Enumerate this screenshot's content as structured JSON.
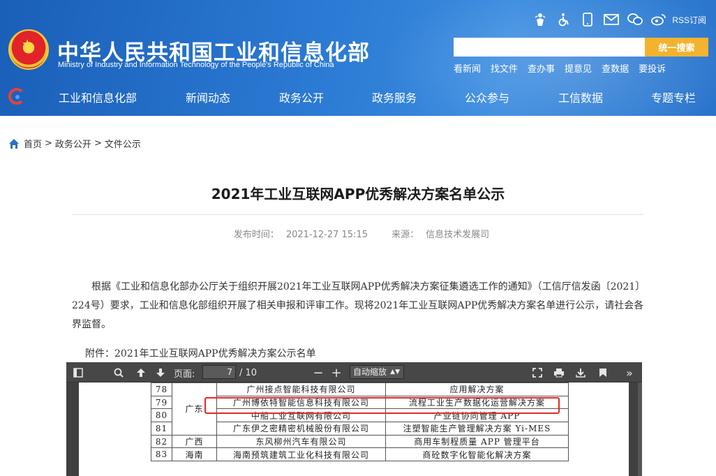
{
  "header": {
    "title": "中华人民共和国工业和信息化部",
    "subtitle": "Ministry of Industry and Information Technology of the People's Republic of China",
    "rss_label": "RSS订阅",
    "search": {
      "placeholder": "",
      "button": "统一搜索"
    },
    "quick_links": [
      "看新闻",
      "找文件",
      "查办事",
      "提意见",
      "查数据",
      "要投诉"
    ],
    "nav": [
      "工业和信息化部",
      "新闻动态",
      "政务公开",
      "政务服务",
      "公众参与",
      "工信数据",
      "专题专栏"
    ],
    "top_icons": [
      "accessibility-elder-icon",
      "wheelchair-icon",
      "mobile-icon",
      "mail-icon",
      "wechat-icon",
      "weibo-icon"
    ]
  },
  "breadcrumb": [
    "首页",
    "政务公开",
    "文件公示"
  ],
  "article": {
    "title": "2021年工业互联网APP优秀解决方案名单公示",
    "publish_label": "发布时间：",
    "publish_time": "2021-12-27 15:15",
    "source_label": "来源：",
    "source": "信息技术发展司",
    "body": "根据《工业和信息化部办公厅关于组织开展2021年工业互联网APP优秀解决方案征集遴选工作的通知》（工信厅信发函〔2021〕224号）要求，工业和信息化部组织开展了相关申报和评审工作。现将2021年工业互联网APP优秀解决方案名单进行公示，请社会各界监督。",
    "attachment": "附件：2021年工业互联网APP优秀解决方案公示名单"
  },
  "pdf_viewer": {
    "page_label": "页面:",
    "current_page": "7",
    "total_pages": "/ 10",
    "zoom": "自动缩放",
    "rows": [
      {
        "no": "78",
        "prov": "",
        "company": "广州接点智能科技有限公司",
        "solution": "应用解决方案"
      },
      {
        "no": "79",
        "prov": "广东",
        "company": "广州博依特智能信息科技有限公司",
        "solution": "流程工业生产数据化运营解决方案"
      },
      {
        "no": "80",
        "prov": "",
        "company": "中船工业互联网有限公司",
        "solution": "产业链协同管理 APP"
      },
      {
        "no": "81",
        "prov": "",
        "company": "广东伊之密精密机械股份有限公司",
        "solution": "注塑智能生产管理解决方案 Yi-MES"
      },
      {
        "no": "82",
        "prov": "广西",
        "company": "东风柳州汽车有限公司",
        "solution": "商用车制程质量 APP 管理平台"
      },
      {
        "no": "83",
        "prov": "海南",
        "company": "海南预筑建筑工业化科技有限公司",
        "solution": "商砼数字化智能化解决方案"
      }
    ]
  },
  "colors": {
    "header_blue": "#2b7ad4",
    "search_button": "#f4b32e",
    "highlight": "#e22a2a"
  }
}
